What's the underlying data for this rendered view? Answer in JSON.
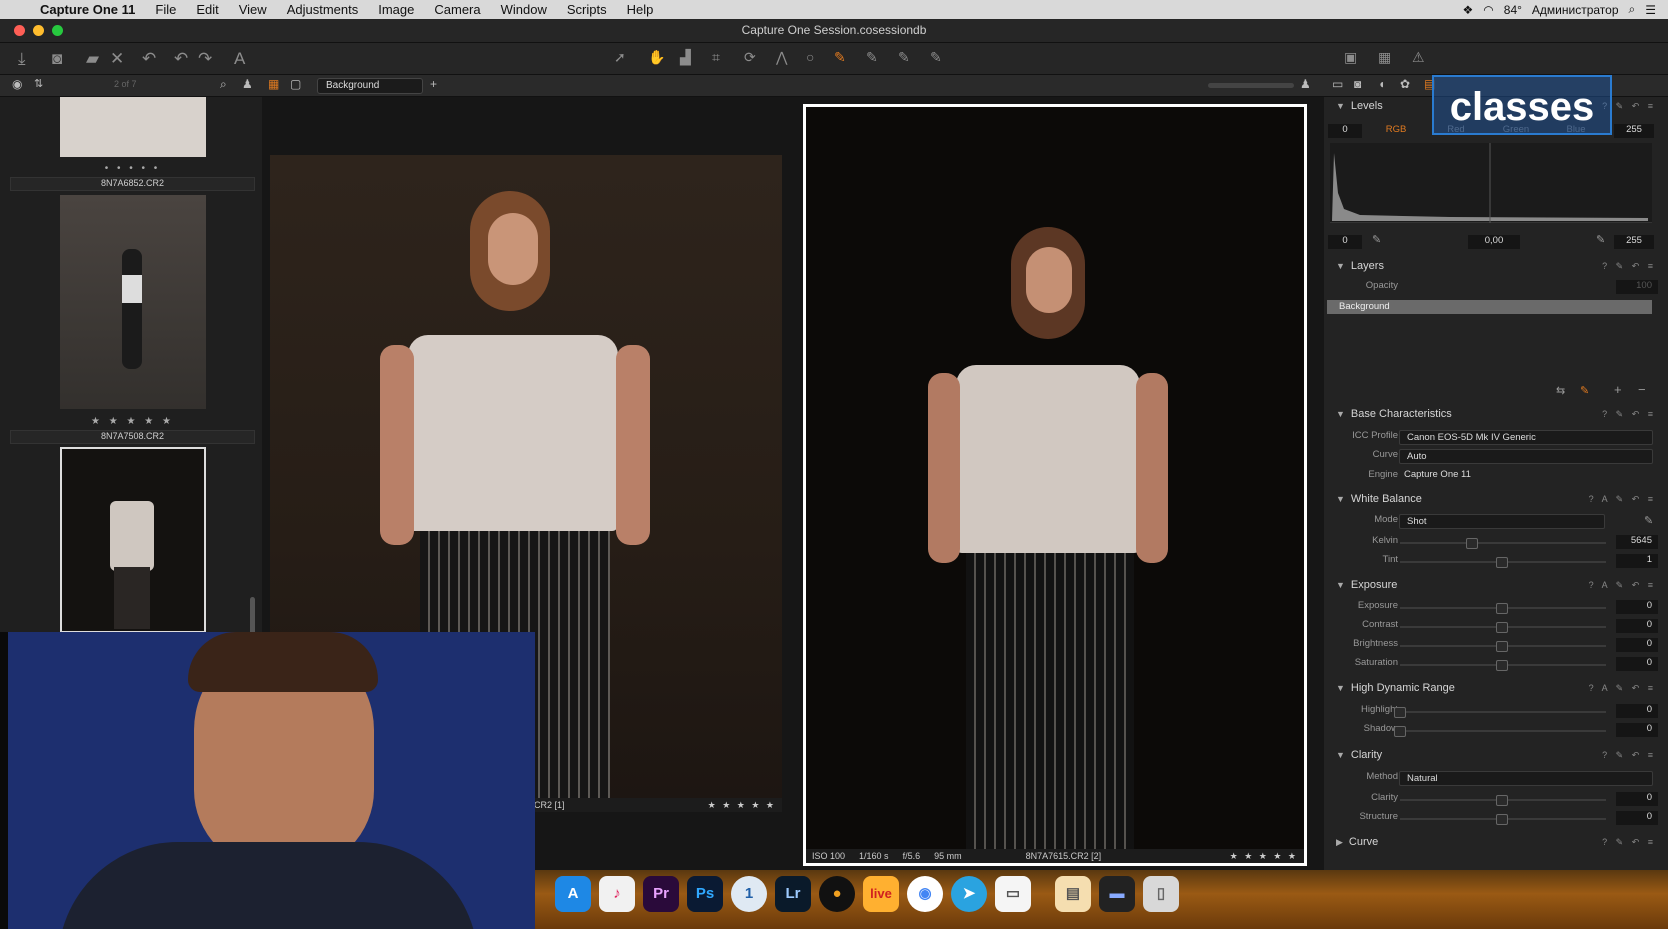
{
  "menubar": {
    "apple": "",
    "items": [
      "Capture One 11",
      "File",
      "Edit",
      "View",
      "Adjustments",
      "Image",
      "Camera",
      "Window",
      "Scripts",
      "Help"
    ],
    "status": [
      "84°",
      "Администратор"
    ]
  },
  "window": {
    "title": "Capture One Session.cosessiondb"
  },
  "subbar": {
    "count": "2 of 7",
    "variant_select": "Background"
  },
  "browser": {
    "thumbs": [
      {
        "stars": "• • • • •",
        "name": "8N7A6852.CR2"
      },
      {
        "stars": "★ ★ ★ ★ ★",
        "name": "8N7A7508.CR2"
      }
    ]
  },
  "viewer": {
    "left_caption": "CR2 [1]",
    "left_stars": "★ ★ ★ ★ ★",
    "right_caption": {
      "iso": "ISO 100",
      "shutter": "1/160 s",
      "aperture": "f/5.6",
      "focal": "95 mm",
      "name": "8N7A7615.CR2 [2]",
      "stars": "★ ★ ★ ★ ★"
    }
  },
  "watermark": {
    "text": "classes"
  },
  "inspector": {
    "levels": {
      "title": "Levels",
      "channels": [
        "RGB",
        "Red",
        "Green",
        "Blue"
      ],
      "in_low": "0",
      "in_high": "255",
      "out_low": "0",
      "midpoint": "0,00",
      "out_high": "255"
    },
    "layers": {
      "title": "Layers",
      "opacity_label": "Opacity",
      "opacity_value": "100",
      "layer": "Background"
    },
    "base": {
      "title": "Base Characteristics",
      "icc_label": "ICC Profile",
      "icc_value": "Canon EOS-5D Mk IV Generic",
      "curve_label": "Curve",
      "curve_value": "Auto",
      "engine_label": "Engine",
      "engine_value": "Capture One 11"
    },
    "wb": {
      "title": "White Balance",
      "mode_label": "Mode",
      "mode_value": "Shot",
      "kelvin_label": "Kelvin",
      "kelvin_value": "5645",
      "tint_label": "Tint",
      "tint_value": "1"
    },
    "exposure": {
      "title": "Exposure",
      "rows": [
        {
          "label": "Exposure",
          "value": "0"
        },
        {
          "label": "Contrast",
          "value": "0"
        },
        {
          "label": "Brightness",
          "value": "0"
        },
        {
          "label": "Saturation",
          "value": "0"
        }
      ]
    },
    "hdr": {
      "title": "High Dynamic Range",
      "rows": [
        {
          "label": "Highlight",
          "value": "0"
        },
        {
          "label": "Shadow",
          "value": "0"
        }
      ]
    },
    "clarity": {
      "title": "Clarity",
      "method_label": "Method",
      "method_value": "Natural",
      "rows": [
        {
          "label": "Clarity",
          "value": "0"
        },
        {
          "label": "Structure",
          "value": "0"
        }
      ]
    },
    "curve": {
      "title": "Curve"
    }
  },
  "dock": {
    "apps": [
      "Pr",
      "Ps",
      "Lr",
      "live"
    ]
  }
}
